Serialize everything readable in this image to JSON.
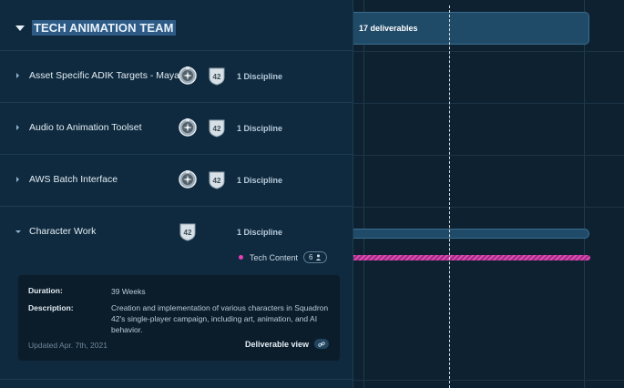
{
  "team": {
    "title": "TECH ANIMATION TEAM"
  },
  "timeline": {
    "summary_label": "17 deliverables"
  },
  "rows": [
    {
      "name": "Asset Specific ADIK Targets - Maya",
      "discipline": "1 Discipline",
      "badges": [
        "compass-badge-icon",
        "squadron-42-badge-icon"
      ]
    },
    {
      "name": "Audio to Animation Toolset",
      "discipline": "1 Discipline",
      "badges": [
        "compass-badge-icon",
        "squadron-42-badge-icon"
      ]
    },
    {
      "name": "AWS Batch Interface",
      "discipline": "1 Discipline",
      "badges": [
        "compass-badge-icon",
        "squadron-42-badge-icon"
      ]
    },
    {
      "name": "Character Work",
      "discipline": "1 Discipline",
      "badges": [
        "squadron-42-badge-icon"
      ]
    }
  ],
  "badge_text": "42",
  "tech_content": {
    "label": "Tech Content",
    "count": "6"
  },
  "details": {
    "duration_label": "Duration:",
    "duration_value": "39 Weeks",
    "description_label": "Description:",
    "description_value": "Creation and implementation of various characters in Squadron 42's single-player campaign, including art, animation, and AI behavior.",
    "updated": "Updated Apr. 7th, 2021",
    "deliverable_view": "Deliverable view"
  },
  "colors": {
    "accent_pink": "#e63fb3",
    "bar_blue": "#1f4a68",
    "highlight": "#2d5b86"
  }
}
